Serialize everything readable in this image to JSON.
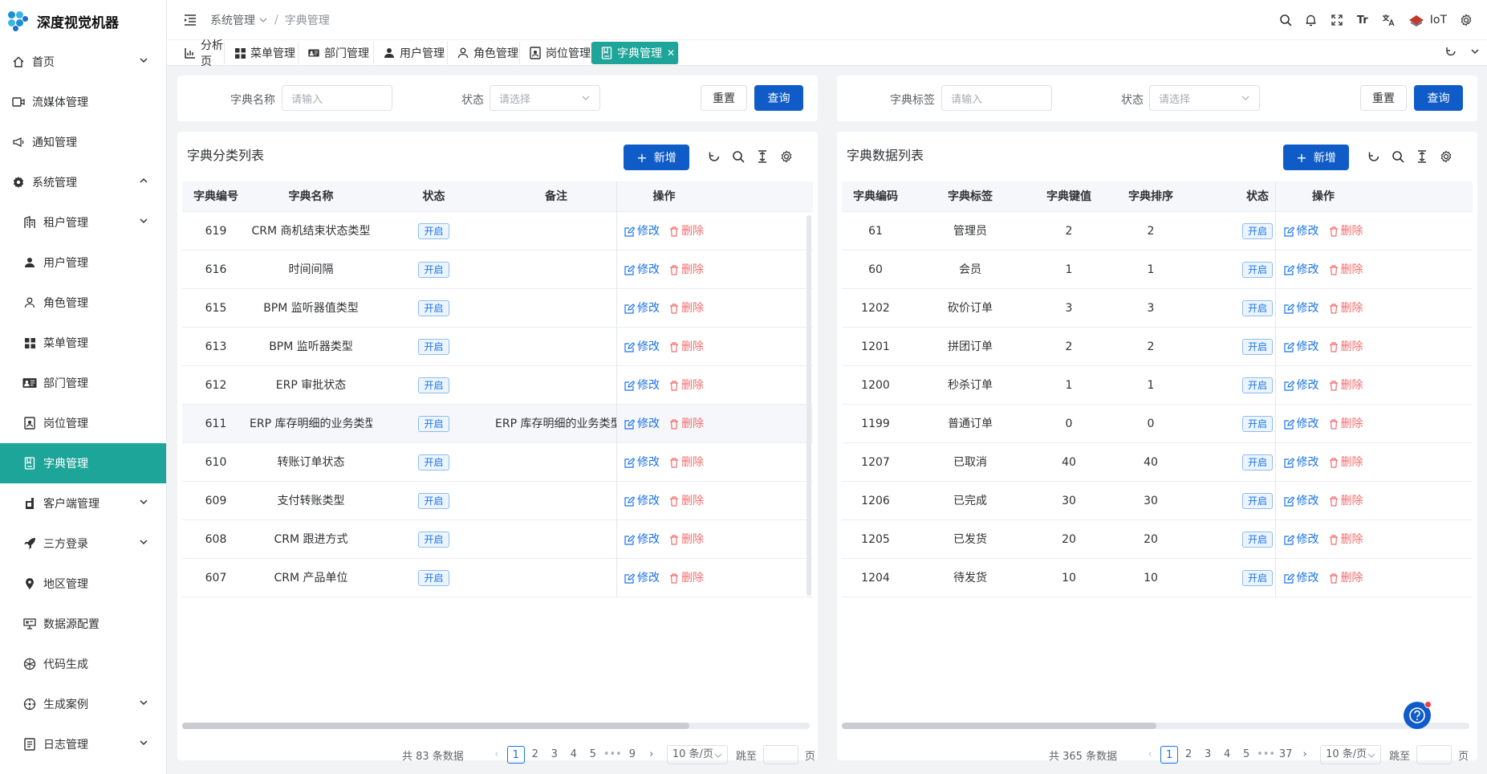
{
  "app": {
    "title": "深度视觉机器"
  },
  "sidebar": {
    "items": [
      {
        "label": "首页",
        "icon": "home-icon",
        "level": 1,
        "arrow": "down"
      },
      {
        "label": "流媒体管理",
        "icon": "video-icon",
        "level": 1,
        "arrow": ""
      },
      {
        "label": "通知管理",
        "icon": "megaphone-icon",
        "level": 1,
        "arrow": ""
      },
      {
        "label": "系统管理",
        "icon": "gear-icon",
        "level": 1,
        "arrow": "up"
      },
      {
        "label": "租户管理",
        "icon": "office-icon",
        "level": 2,
        "arrow": "down"
      },
      {
        "label": "用户管理",
        "icon": "user-icon",
        "level": 2,
        "arrow": ""
      },
      {
        "label": "角色管理",
        "icon": "user-outline-icon",
        "level": 2,
        "arrow": ""
      },
      {
        "label": "菜单管理",
        "icon": "grid-icon",
        "level": 2,
        "arrow": ""
      },
      {
        "label": "部门管理",
        "icon": "id-card-icon",
        "level": 2,
        "arrow": ""
      },
      {
        "label": "岗位管理",
        "icon": "badge-icon",
        "level": 2,
        "arrow": ""
      },
      {
        "label": "字典管理",
        "icon": "dictionary-icon",
        "level": 2,
        "arrow": "",
        "active": true
      },
      {
        "label": "客户端管理",
        "icon": "client-icon",
        "level": 2,
        "arrow": "down"
      },
      {
        "label": "三方登录",
        "icon": "rocket-icon",
        "level": 2,
        "arrow": "down"
      },
      {
        "label": "地区管理",
        "icon": "location-pin-icon",
        "level": 2,
        "arrow": ""
      },
      {
        "label": "数据源配置",
        "icon": "datasource-icon",
        "level": 2,
        "arrow": ""
      },
      {
        "label": "代码生成",
        "icon": "code-icon",
        "level": 2,
        "arrow": ""
      },
      {
        "label": "生成案例",
        "icon": "compass-icon",
        "level": 2,
        "arrow": "down"
      },
      {
        "label": "日志管理",
        "icon": "log-icon",
        "level": 2,
        "arrow": "down"
      }
    ]
  },
  "header": {
    "breadcrumb": [
      "系统管理",
      "字典管理"
    ],
    "iot_label": "IoT",
    "font_icon_text": "Tr"
  },
  "tabs": [
    {
      "label": "分析页",
      "icon": "chart-icon"
    },
    {
      "label": "菜单管理",
      "icon": "grid-icon"
    },
    {
      "label": "部门管理",
      "icon": "id-card-icon"
    },
    {
      "label": "用户管理",
      "icon": "user-icon"
    },
    {
      "label": "角色管理",
      "icon": "user-outline-icon"
    },
    {
      "label": "岗位管理",
      "icon": "badge-icon"
    },
    {
      "label": "字典管理",
      "icon": "dictionary-icon",
      "active": true
    }
  ],
  "left": {
    "query": {
      "name_label": "字典名称",
      "name_placeholder": "请输入",
      "status_label": "状态",
      "status_placeholder": "请选择",
      "reset": "重置",
      "search": "查询"
    },
    "title": "字典分类列表",
    "add": "新增",
    "columns": [
      "字典编号",
      "字典名称",
      "状态",
      "备注",
      "操作"
    ],
    "rows": [
      {
        "id": "619",
        "name": "CRM 商机结束状态类型",
        "status": "开启",
        "remark": ""
      },
      {
        "id": "616",
        "name": "时间间隔",
        "status": "开启",
        "remark": ""
      },
      {
        "id": "615",
        "name": "BPM 监听器值类型",
        "status": "开启",
        "remark": ""
      },
      {
        "id": "613",
        "name": "BPM 监听器类型",
        "status": "开启",
        "remark": ""
      },
      {
        "id": "612",
        "name": "ERP 审批状态",
        "status": "开启",
        "remark": ""
      },
      {
        "id": "611",
        "name": "ERP 库存明细的业务类型",
        "status": "开启",
        "remark": "ERP 库存明细的业务类型"
      },
      {
        "id": "610",
        "name": "转账订单状态",
        "status": "开启",
        "remark": ""
      },
      {
        "id": "609",
        "name": "支付转账类型",
        "status": "开启",
        "remark": ""
      },
      {
        "id": "608",
        "name": "CRM 跟进方式",
        "status": "开启",
        "remark": ""
      },
      {
        "id": "607",
        "name": "CRM 产品单位",
        "status": "开启",
        "remark": ""
      }
    ],
    "edit": "修改",
    "delete": "删除",
    "pager": {
      "total": "共 83 条数据",
      "pages": [
        "1",
        "2",
        "3",
        "4",
        "5",
        "•••",
        "9"
      ],
      "size": "10 条/页",
      "jump": "跳至",
      "unit": "页"
    }
  },
  "right": {
    "query": {
      "label_label": "字典标签",
      "label_placeholder": "请输入",
      "status_label": "状态",
      "status_placeholder": "请选择",
      "reset": "重置",
      "search": "查询"
    },
    "title": "字典数据列表",
    "add": "新增",
    "columns": [
      "字典编码",
      "字典标签",
      "字典键值",
      "字典排序",
      "状态",
      "操作"
    ],
    "rows": [
      {
        "code": "61",
        "label": "管理员",
        "value": "2",
        "sort": "2",
        "status": "开启"
      },
      {
        "code": "60",
        "label": "会员",
        "value": "1",
        "sort": "1",
        "status": "开启"
      },
      {
        "code": "1202",
        "label": "砍价订单",
        "value": "3",
        "sort": "3",
        "status": "开启"
      },
      {
        "code": "1201",
        "label": "拼团订单",
        "value": "2",
        "sort": "2",
        "status": "开启"
      },
      {
        "code": "1200",
        "label": "秒杀订单",
        "value": "1",
        "sort": "1",
        "status": "开启"
      },
      {
        "code": "1199",
        "label": "普通订单",
        "value": "0",
        "sort": "0",
        "status": "开启"
      },
      {
        "code": "1207",
        "label": "已取消",
        "value": "40",
        "sort": "40",
        "status": "开启"
      },
      {
        "code": "1206",
        "label": "已完成",
        "value": "30",
        "sort": "30",
        "status": "开启"
      },
      {
        "code": "1205",
        "label": "已发货",
        "value": "20",
        "sort": "20",
        "status": "开启"
      },
      {
        "code": "1204",
        "label": "待发货",
        "value": "10",
        "sort": "10",
        "status": "开启"
      }
    ],
    "edit": "修改",
    "delete": "删除",
    "pager": {
      "total": "共 365 条数据",
      "pages": [
        "1",
        "2",
        "3",
        "4",
        "5",
        "•••",
        "37"
      ],
      "size": "10 条/页",
      "jump": "跳至",
      "unit": "页"
    }
  },
  "colors": {
    "accent": "#1ea59a",
    "primary": "#0f5cc8",
    "danger": "#f56c6c",
    "link": "#1a73e8"
  }
}
